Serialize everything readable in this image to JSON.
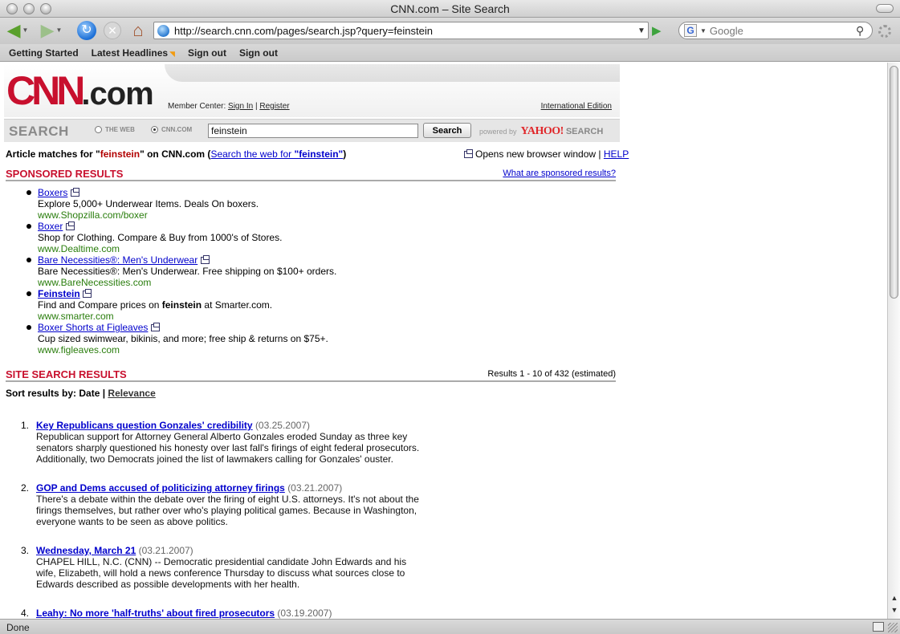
{
  "window": {
    "title": "CNN.com – Site Search"
  },
  "toolbar": {
    "url": "http://search.cnn.com/pages/search.jsp?query=feinstein",
    "search_placeholder": "Google"
  },
  "bookmarks": [
    {
      "label": "Getting Started"
    },
    {
      "label": "Latest Headlines"
    },
    {
      "label": "Sign out"
    },
    {
      "label": "Sign out"
    }
  ],
  "header": {
    "logo_cnn": "CNN",
    "logo_suffix": ".com",
    "member_label": "Member Center:",
    "sign_in": "Sign In",
    "separator": "|",
    "register": "Register",
    "international": "International Edition"
  },
  "searchbar": {
    "label": "SEARCH",
    "radio_web": "THE WEB",
    "radio_cnn": "CNN.COM",
    "query": "feinstein",
    "button": "Search",
    "powered_by": "powered by",
    "yahoo": "YAHOO!",
    "yahoo_search": "SEARCH"
  },
  "matches": {
    "prefix": "Article matches for \"",
    "query": "feinstein",
    "middle": "\" on CNN.com (",
    "web_link_prefix": "Search the web for ",
    "web_link_query": "\"feinstein\"",
    "suffix": ")",
    "opens_window": "Opens new browser window |",
    "help": "HELP"
  },
  "sponsored": {
    "title": "SPONSORED RESULTS",
    "what_link": "What are sponsored results?",
    "items": [
      {
        "title": "Boxers",
        "desc_parts": [
          "Explore 5,000+ Underwear Items. Deals On boxers."
        ],
        "url": "www.Shopzilla.com/boxer"
      },
      {
        "title": "Boxer",
        "desc_parts": [
          "Shop for Clothing. Compare & Buy from 1000's of Stores."
        ],
        "url": "www.Dealtime.com"
      },
      {
        "title": "Bare Necessities®: Men's Underwear",
        "desc_parts": [
          "Bare Necessities®: Men's Underwear. Free shipping on $100+ orders."
        ],
        "url": "www.BareNecessities.com"
      },
      {
        "title": "Feinstein",
        "desc_pre": "Find and Compare prices on ",
        "desc_kw": "feinstein",
        "desc_post": " at Smarter.com.",
        "url": "www.smarter.com"
      },
      {
        "title": "Boxer Shorts at Figleaves",
        "desc_parts": [
          "Cup sized swimwear, bikinis, and more; free ship & returns on $75+."
        ],
        "url": "www.figleaves.com"
      }
    ]
  },
  "site_results": {
    "title": "SITE SEARCH RESULTS",
    "count": "Results 1 - 10 of 432 (estimated)",
    "sort_label": "Sort results by: Date |",
    "sort_relevance": "Relevance",
    "items": [
      {
        "num": "1.",
        "title": "Key Republicans question Gonzales' credibility",
        "date": "(03.25.2007)",
        "desc": "Republican support for Attorney General Alberto Gonzales eroded Sunday as three key senators sharply questioned his honesty over last fall's firings of eight federal prosecutors. Additionally, two Democrats joined the list of lawmakers calling for Gonzales' ouster."
      },
      {
        "num": "2.",
        "title": "GOP and Dems accused of politicizing attorney firings",
        "date": "(03.21.2007)",
        "desc": "There's a debate within the debate over the firing of eight U.S. attorneys. It's not about the firings themselves, but rather over who's playing political games. Because in Washington, everyone wants to be seen as above politics."
      },
      {
        "num": "3.",
        "title": "Wednesday, March 21",
        "date": "(03.21.2007)",
        "desc": "CHAPEL HILL, N.C. (CNN) -- Democratic presidential candidate John Edwards and his wife, Elizabeth, will hold a news conference Thursday to discuss what sources close to Edwards described as possible developments with her health."
      },
      {
        "num": "4.",
        "title": "Leahy: No more 'half-truths' about fired prosecutors",
        "date": "(03.19.2007)",
        "desc": ""
      }
    ]
  },
  "status": {
    "text": "Done"
  }
}
